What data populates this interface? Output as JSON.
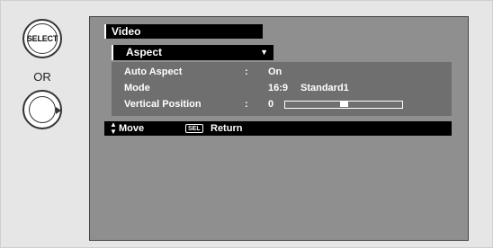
{
  "remote": {
    "select_label": "SELECT",
    "or_label": "OR"
  },
  "menu": {
    "title": "Video",
    "submenu": "Aspect",
    "dropdown_icon": "triangle-down",
    "rows": [
      {
        "label": "Auto Aspect",
        "colon": ":",
        "value": "On"
      },
      {
        "label": "Mode",
        "colon": "",
        "value": "16:9",
        "value2": "Standard1"
      },
      {
        "label": "Vertical Position",
        "colon": ":",
        "value": "0",
        "slider_fraction": 0.5
      }
    ]
  },
  "footer": {
    "move_label": "Move",
    "sel_badge": "SEL",
    "return_label": "Return"
  },
  "colors": {
    "screen_bg": "#8f8f8f",
    "panel_bg": "#6f6f6f",
    "bar_bg": "#000000",
    "text": "#ffffff"
  }
}
